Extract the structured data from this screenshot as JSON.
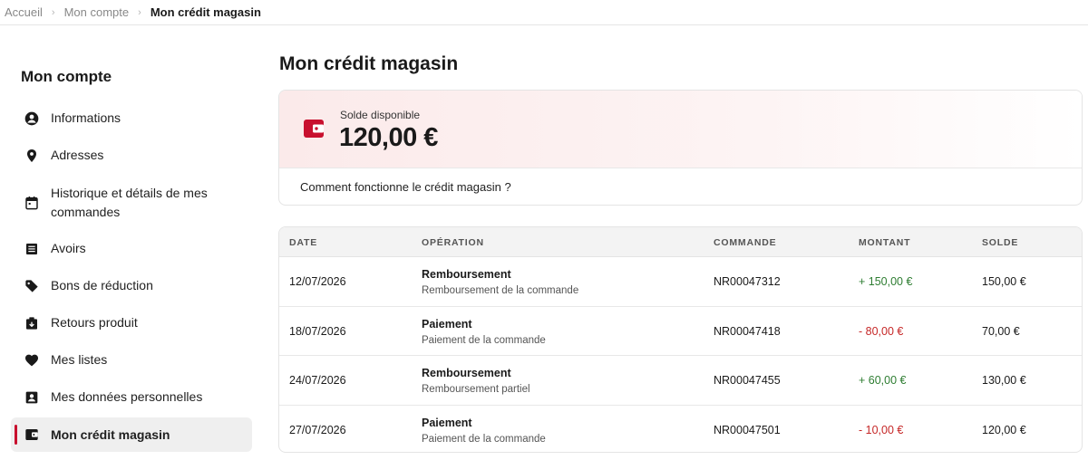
{
  "breadcrumb": {
    "home": "Accueil",
    "account": "Mon compte",
    "current": "Mon crédit magasin"
  },
  "sidebar": {
    "title": "Mon compte",
    "items": [
      {
        "label": "Informations",
        "icon": "user-circle-icon"
      },
      {
        "label": "Adresses",
        "icon": "map-pin-icon"
      },
      {
        "label": "Historique et détails de mes commandes",
        "icon": "calendar-icon"
      },
      {
        "label": "Avoirs",
        "icon": "receipt-icon"
      },
      {
        "label": "Bons de réduction",
        "icon": "tag-icon"
      },
      {
        "label": "Retours produit",
        "icon": "return-box-icon"
      },
      {
        "label": "Mes listes",
        "icon": "heart-icon"
      },
      {
        "label": "Mes données personnelles",
        "icon": "id-card-icon"
      },
      {
        "label": "Mon crédit magasin",
        "icon": "wallet-icon",
        "active": true
      }
    ]
  },
  "main": {
    "title": "Mon crédit magasin",
    "balance_label": "Solde disponible",
    "balance_value": "120,00 €",
    "help_link": "Comment fonctionne le crédit magasin ?"
  },
  "ledger": {
    "columns": [
      "DATE",
      "OPÉRATION",
      "COMMANDE",
      "MONTANT",
      "SOLDE"
    ],
    "rows": [
      {
        "date": "12/07/2026",
        "op_title": "Remboursement",
        "op_sub": "Remboursement de la commande",
        "order": "NR00047312",
        "amount": "+ 150,00 €",
        "balance": "150,00 €"
      },
      {
        "date": "18/07/2026",
        "op_title": "Paiement",
        "op_sub": "Paiement de la commande",
        "order": "NR00047418",
        "amount": "- 80,00 €",
        "balance": "70,00 €"
      },
      {
        "date": "24/07/2026",
        "op_title": "Remboursement",
        "op_sub": "Remboursement partiel",
        "order": "NR00047455",
        "amount": "+ 60,00 €",
        "balance": "130,00 €"
      },
      {
        "date": "27/07/2026",
        "op_title": "Paiement",
        "op_sub": "Paiement de la commande",
        "order": "NR00047501",
        "amount": "- 10,00 €",
        "balance": "120,00 €"
      }
    ]
  },
  "colors": {
    "accent": "#c8102e",
    "positive": "#2e7d32",
    "negative": "#c62828"
  }
}
